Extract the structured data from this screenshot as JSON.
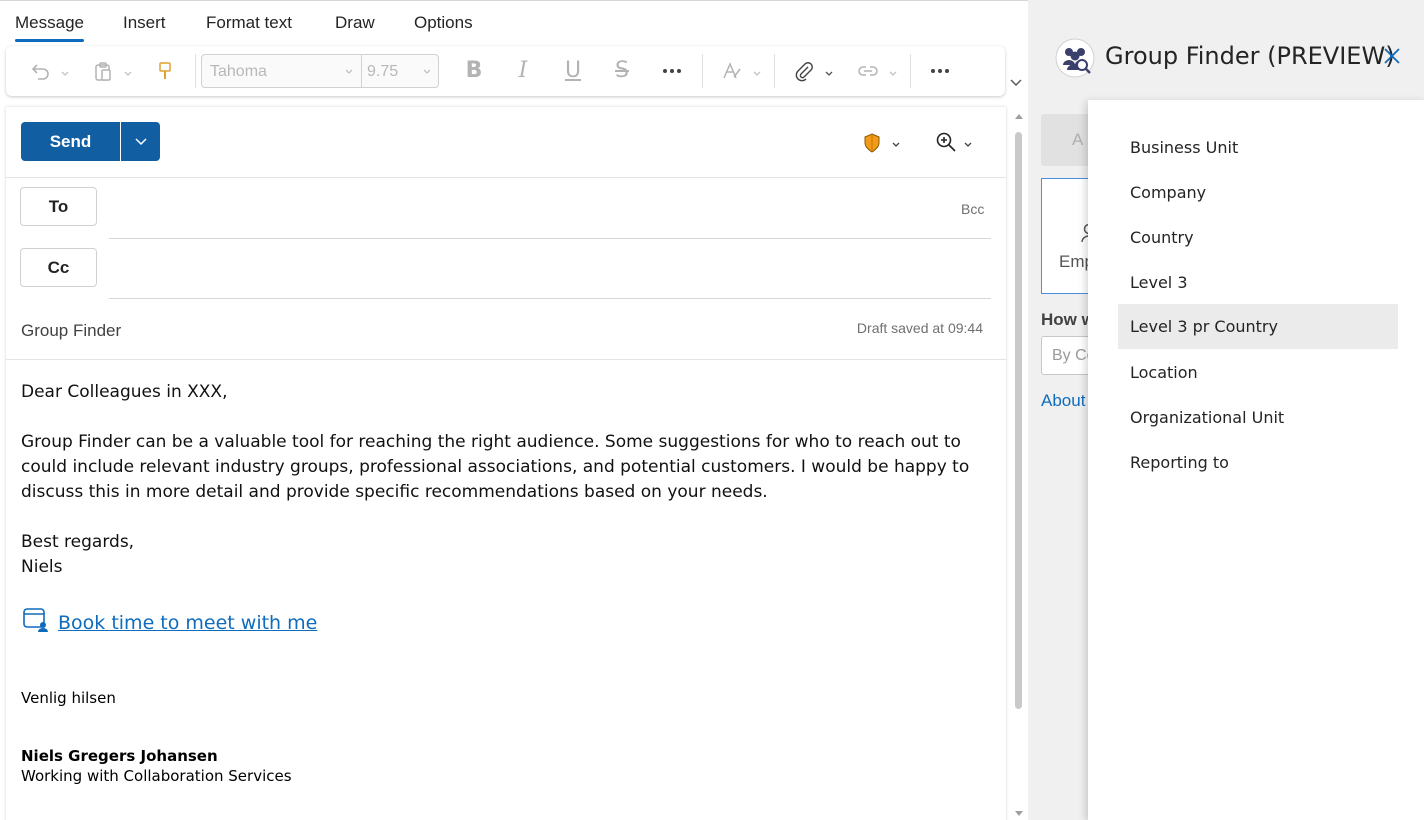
{
  "ribbon": {
    "tabs": [
      {
        "label": "Message"
      },
      {
        "label": "Insert"
      },
      {
        "label": "Format text"
      },
      {
        "label": "Draw"
      },
      {
        "label": "Options"
      }
    ]
  },
  "toolbar": {
    "font_name": "Tahoma",
    "font_size": "9.75",
    "icons": [
      "undo-icon",
      "paste-icon",
      "format-painter-icon",
      "bold-icon",
      "italic-icon",
      "underline-icon",
      "strikethrough-icon",
      "more-icon",
      "styles-icon",
      "attach-icon",
      "link-icon",
      "more-icon"
    ]
  },
  "compose": {
    "send_label": "Send",
    "to_label": "To",
    "cc_label": "Cc",
    "bcc_label": "Bcc",
    "subject": "Group Finder",
    "draft_status": "Draft saved at 09:44",
    "body": {
      "greeting": "Dear  Colleagues in XXX,",
      "paragraph_lines": [
        "Group Finder can be a valuable tool for reaching the right audience. Some suggestions for who to reach out to",
        "could include relevant industry groups, professional associations, and potential customers. I would be happy to",
        "discuss this in more detail and provide specific recommendations based on your needs."
      ],
      "closing": "Best regards,",
      "name": "Niels",
      "booking_link": "Book time to meet with me",
      "sig_greeting": "Venlig hilsen",
      "sig_name": "Niels Gregers Johansen",
      "sig_title": "Working with Collaboration Services"
    }
  },
  "side_panel": {
    "title": "Group Finder (PREVIEW)",
    "behind": {
      "button_fragment": "A",
      "card_fragment": "Emp",
      "question_fragment": "How w",
      "input_fragment": "By Co",
      "link_fragment": "About"
    },
    "dropdown_items": [
      {
        "label": "Business Unit"
      },
      {
        "label": "Company"
      },
      {
        "label": "Country"
      },
      {
        "label": "Level 3"
      },
      {
        "label": "Level 3 pr Country",
        "hover": true
      },
      {
        "label": "Location"
      },
      {
        "label": "Organizational Unit"
      },
      {
        "label": "Reporting to"
      }
    ]
  },
  "colors": {
    "accent": "#115ea3",
    "link": "#0f6cbd",
    "shield": "#f29b1a"
  }
}
